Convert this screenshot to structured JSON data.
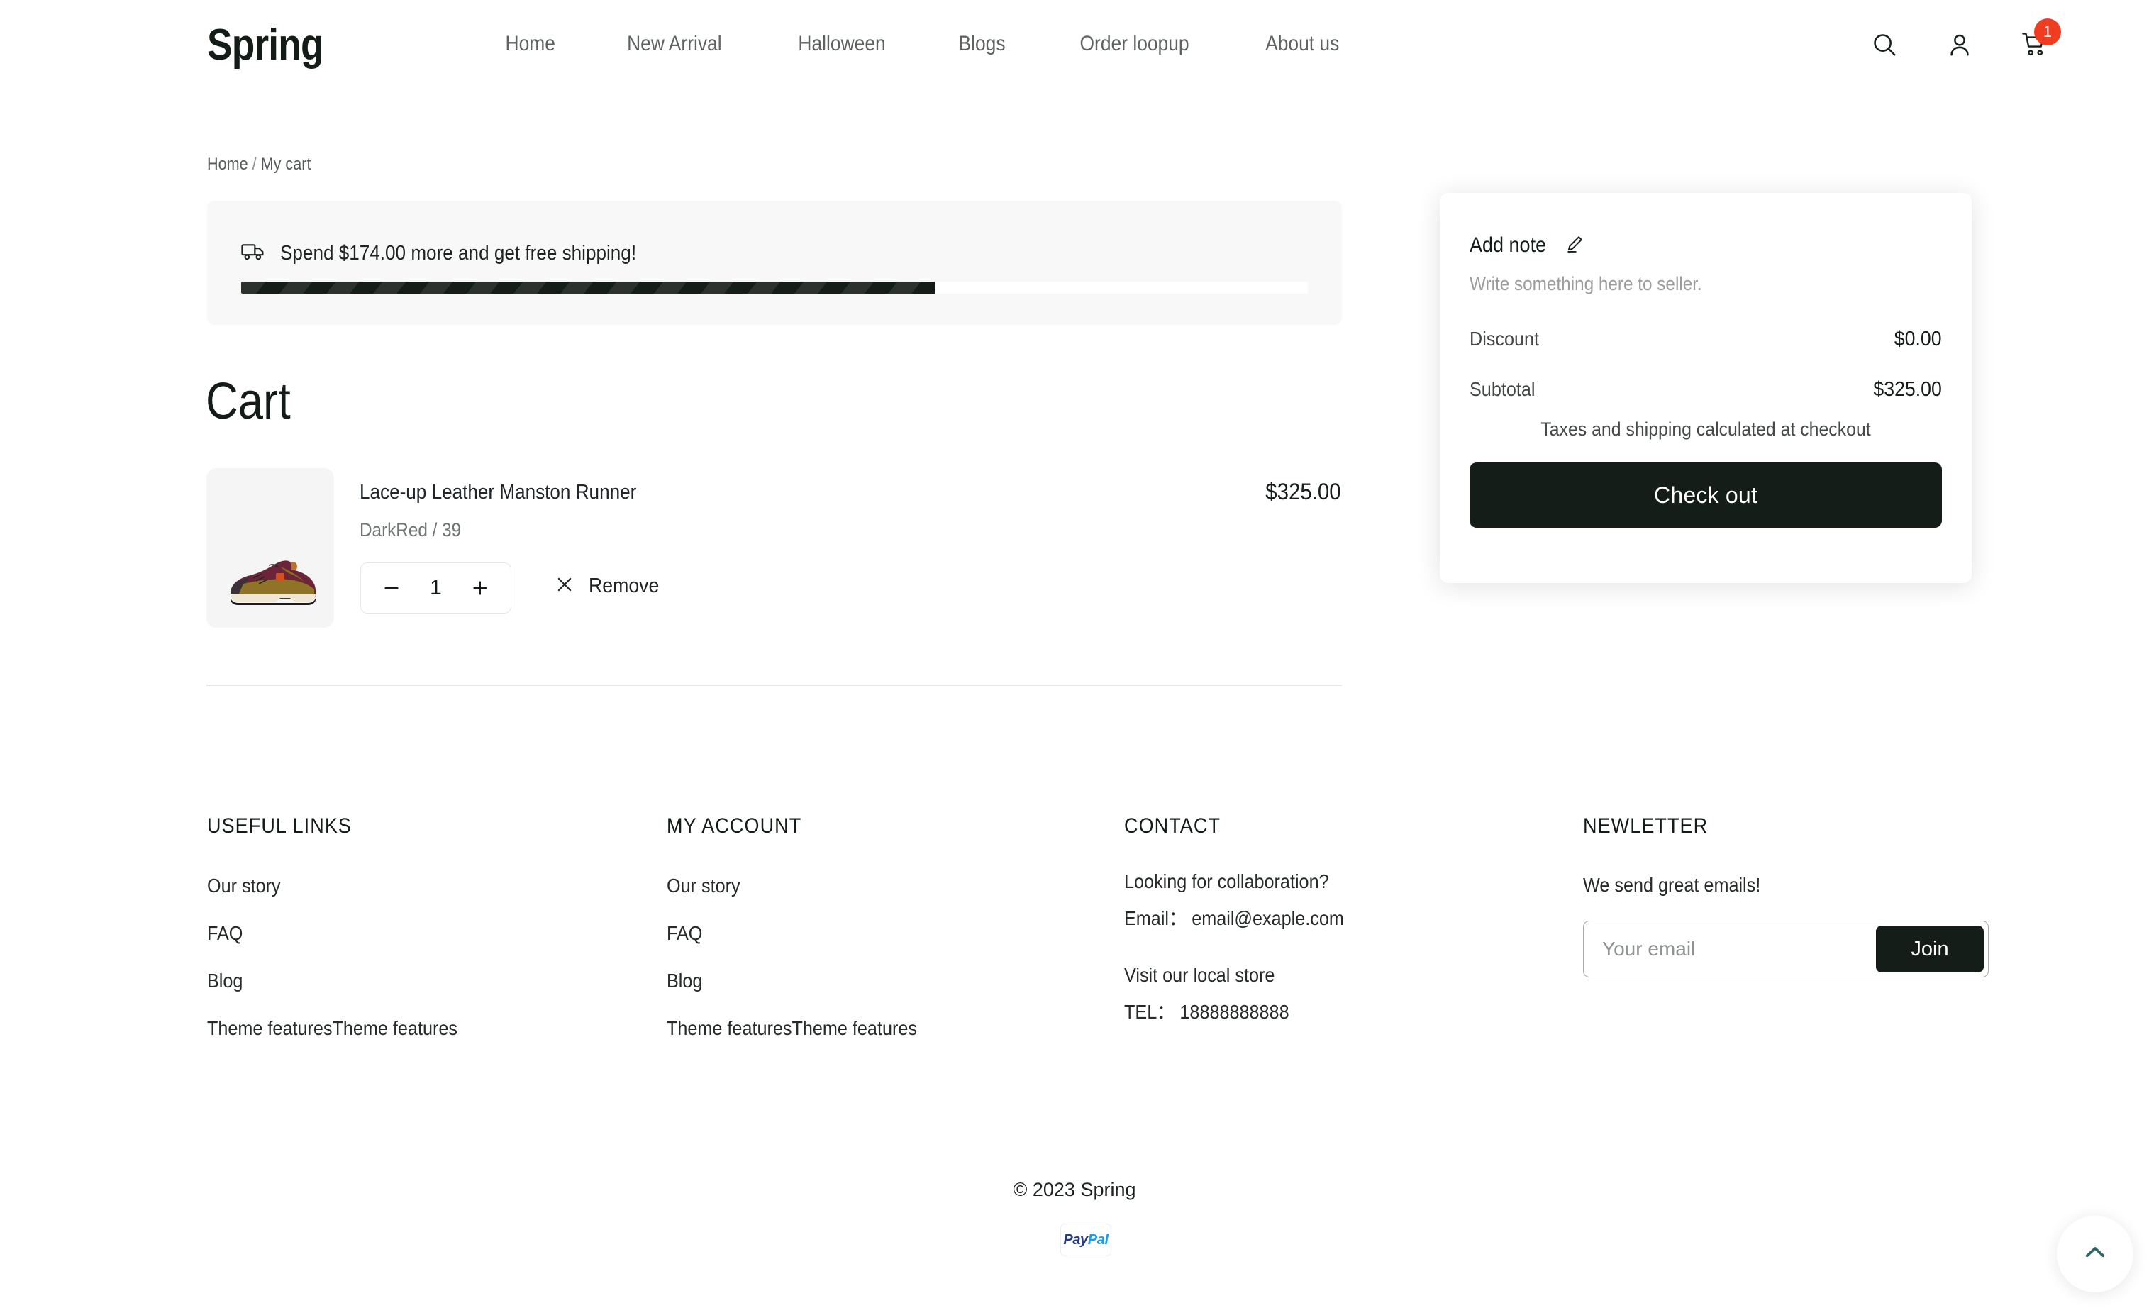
{
  "header": {
    "logo": "Spring",
    "nav": [
      {
        "label": "Home"
      },
      {
        "label": "New Arrival"
      },
      {
        "label": "Halloween"
      },
      {
        "label": "Blogs"
      },
      {
        "label": "Order loopup"
      },
      {
        "label": "About us"
      }
    ],
    "icons": {
      "search": "search-icon",
      "account": "account-icon",
      "cart": "cart-icon"
    },
    "cart_count": "1",
    "cart_badge_color": "#f03c20"
  },
  "breadcrumb": {
    "home": "Home",
    "separator": "/",
    "current": "My cart"
  },
  "shipping_banner": {
    "icon": "truck-icon",
    "message": "Spend $174.00 more and get free shipping!",
    "progress_percent": 65,
    "bar_color": "#141d17",
    "background": "#f8f8f8"
  },
  "cart": {
    "title": "Cart",
    "items": [
      {
        "name": "Lace-up Leather Manston Runner",
        "variant": "DarkRed / 39",
        "price": "$325.00",
        "quantity": "1",
        "decrease_label": "−",
        "increase_label": "+",
        "remove_label": "Remove",
        "image": "burgundy-sneaker"
      }
    ]
  },
  "summary": {
    "add_note_label": "Add note",
    "add_note_icon": "pencil-icon",
    "note_placeholder": "Write something here to seller.",
    "discount_label": "Discount",
    "discount_value": "$0.00",
    "subtotal_label": "Subtotal",
    "subtotal_value": "$325.00",
    "tax_note": "Taxes and shipping calculated at checkout",
    "checkout_label": "Check out",
    "checkout_color": "#141d17"
  },
  "footer": {
    "useful_links": {
      "title": "USEFUL LINKS",
      "links": [
        "Our story",
        "FAQ",
        "Blog",
        "Theme featuresTheme features"
      ]
    },
    "my_account": {
      "title": "MY ACCOUNT",
      "links": [
        "Our story",
        "FAQ",
        "Blog",
        "Theme featuresTheme features"
      ]
    },
    "contact": {
      "title": "CONTACT",
      "line1": "Looking for collaboration?",
      "line2": "Email：  email@exaple.com",
      "line3": "Visit our local store",
      "line4": "TEL：  18888888888"
    },
    "newsletter": {
      "title": "NEWLETTER",
      "subtitle": "We send great emails!",
      "placeholder": "Your email",
      "value": "",
      "join_label": "Join"
    }
  },
  "bottom": {
    "copyright": "© 2023 Spring",
    "payment_icon": "paypal-icon",
    "paypal_a": "Pay",
    "paypal_b": "Pal",
    "scroll_top_icon": "chevron-up-icon"
  }
}
